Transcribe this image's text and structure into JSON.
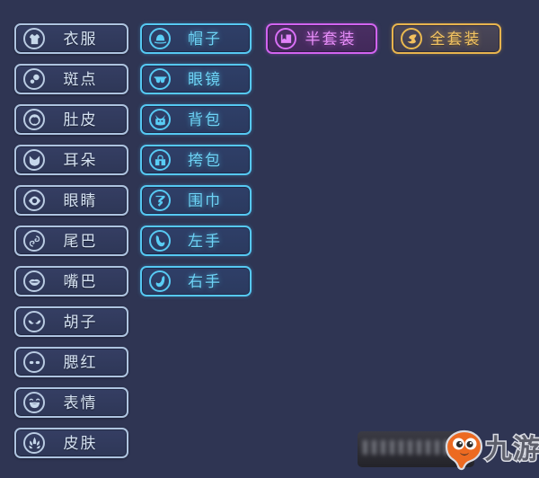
{
  "background_color": "#2f3553",
  "theme": {
    "idle_border": "#aec4e0",
    "idle_text": "#d5e2f2",
    "cyan_accent": "#56c8f2",
    "purple_accent": "#d264f0",
    "gold_accent": "#e8b44e"
  },
  "panel": {
    "columns": [
      {
        "name": "body-parts-column",
        "items": [
          {
            "label": "衣服",
            "icon": "shirt-icon",
            "state": "idle"
          },
          {
            "label": "斑点",
            "icon": "spots-icon",
            "state": "idle"
          },
          {
            "label": "肚皮",
            "icon": "belly-icon",
            "state": "idle"
          },
          {
            "label": "耳朵",
            "icon": "ears-icon",
            "state": "idle"
          },
          {
            "label": "眼睛",
            "icon": "eye-icon",
            "state": "idle"
          },
          {
            "label": "尾巴",
            "icon": "tail-icon",
            "state": "idle"
          },
          {
            "label": "嘴巴",
            "icon": "mouth-icon",
            "state": "idle"
          },
          {
            "label": "胡子",
            "icon": "whiskers-icon",
            "state": "idle"
          },
          {
            "label": "腮红",
            "icon": "blush-icon",
            "state": "idle"
          },
          {
            "label": "表情",
            "icon": "expression-icon",
            "state": "idle"
          },
          {
            "label": "皮肤",
            "icon": "skin-icon",
            "state": "idle"
          }
        ]
      },
      {
        "name": "accessories-column",
        "items": [
          {
            "label": "帽子",
            "icon": "hat-icon",
            "state": "cyan"
          },
          {
            "label": "眼镜",
            "icon": "glasses-icon",
            "state": "cyan"
          },
          {
            "label": "背包",
            "icon": "backpack-icon",
            "state": "cyan"
          },
          {
            "label": "挎包",
            "icon": "satchel-icon",
            "state": "cyan"
          },
          {
            "label": "围巾",
            "icon": "scarf-icon",
            "state": "cyan"
          },
          {
            "label": "左手",
            "icon": "left-hand-icon",
            "state": "cyan"
          },
          {
            "label": "右手",
            "icon": "right-hand-icon",
            "state": "cyan"
          }
        ]
      },
      {
        "name": "sets-column",
        "items": [
          {
            "label": "半套装",
            "icon": "half-set-icon",
            "state": "purple"
          },
          {
            "label": "全套装",
            "icon": "full-set-icon",
            "state": "gold"
          }
        ]
      }
    ]
  },
  "watermark": {
    "name": "jiuyou-watermark",
    "text": "九游",
    "mascot": "jiuyou-mascot-icon",
    "mascot_color": "#ec6a21",
    "bar_label": ""
  }
}
